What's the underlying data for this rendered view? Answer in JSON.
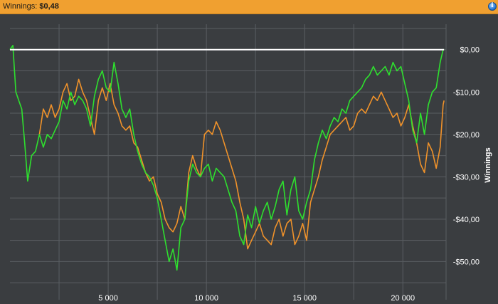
{
  "header": {
    "label": "Winnings:",
    "value": "$0,48",
    "info_icon": "info-icon"
  },
  "colors": {
    "background": "#3a3d40",
    "grid": "#5a5e62",
    "green": "#2ee02e",
    "orange": "#f0922a",
    "white": "#ffffff",
    "header": "#f0a030"
  },
  "chart_data": {
    "type": "line",
    "title": "",
    "xlabel": "",
    "ylabel": "Winnings",
    "grid": true,
    "legend": "none",
    "xlim": [
      0,
      22200
    ],
    "ylim": [
      -59,
      6
    ],
    "x_ticks": [
      5000,
      10000,
      15000,
      20000
    ],
    "x_tick_labels": [
      "5 000",
      "10 000",
      "15 000",
      "20 000"
    ],
    "y_ticks": [
      0,
      -10,
      -20,
      -30,
      -40,
      -50
    ],
    "y_tick_labels": [
      "$0,00",
      "-$10,00",
      "-$20,00",
      "-$30,00",
      "-$40,00",
      "-$50,00"
    ],
    "series": [
      {
        "color": "#2ee02e",
        "x": [
          0,
          150,
          300,
          450,
          600,
          750,
          900,
          1100,
          1300,
          1500,
          1700,
          1900,
          2100,
          2300,
          2500,
          2700,
          2900,
          3100,
          3300,
          3500,
          3700,
          3900,
          4100,
          4300,
          4500,
          4700,
          4900,
          5100,
          5300,
          5500,
          5700,
          5900,
          6100,
          6300,
          6500,
          6700,
          6900,
          7100,
          7300,
          7500,
          7700,
          7900,
          8100,
          8300,
          8500,
          8700,
          8900,
          9100,
          9300,
          9500,
          9700,
          9900,
          10100,
          10300,
          10500,
          10700,
          10900,
          11100,
          11300,
          11500,
          11700,
          11900,
          12100,
          12300,
          12500,
          12700,
          12900,
          13100,
          13300,
          13500,
          13700,
          13900,
          14100,
          14300,
          14500,
          14700,
          14900,
          15100,
          15300,
          15500,
          15700,
          15900,
          16100,
          16300,
          16500,
          16700,
          16900,
          17100,
          17300,
          17500,
          17700,
          17900,
          18100,
          18300,
          18500,
          18700,
          18900,
          19100,
          19300,
          19500,
          19700,
          19900,
          20100,
          20300,
          20500,
          20700,
          20900,
          21100,
          21300,
          21500,
          21700,
          21900,
          22050,
          22100
        ],
        "y": [
          0,
          1,
          -10,
          -12,
          -14,
          -22,
          -31,
          -25,
          -24,
          -20,
          -23,
          -20,
          -21,
          -19,
          -17,
          -12,
          -14,
          -10,
          -13,
          -11,
          -12,
          -14,
          -18,
          -11,
          -7,
          -5,
          -9,
          -10,
          -3,
          -8,
          -14,
          -16,
          -14,
          -20,
          -24,
          -27,
          -29,
          -30,
          -32,
          -35,
          -40,
          -45,
          -50,
          -47,
          -52,
          -42,
          -40,
          -31,
          -27,
          -29,
          -30,
          -28,
          -27,
          -31,
          -28,
          -29,
          -30,
          -33,
          -36,
          -38,
          -44,
          -46,
          -39,
          -42,
          -37,
          -41,
          -38,
          -36,
          -40,
          -37,
          -33,
          -31,
          -39,
          -33,
          -30,
          -38,
          -40,
          -36,
          -33,
          -26,
          -22,
          -19,
          -21,
          -18,
          -16,
          -17,
          -14,
          -15,
          -12,
          -11,
          -10,
          -9,
          -7,
          -6,
          -4,
          -6,
          -5,
          -4,
          -6,
          -3,
          -5,
          -4,
          -8,
          -12,
          -19,
          -22,
          -15,
          -20,
          -13,
          -10,
          -9,
          -3,
          0,
          0
        ]
      },
      {
        "color": "#f0922a",
        "x": [
          1500,
          1700,
          1900,
          2100,
          2300,
          2500,
          2700,
          2900,
          3100,
          3300,
          3500,
          3700,
          3900,
          4100,
          4300,
          4500,
          4700,
          4900,
          5100,
          5300,
          5500,
          5700,
          5900,
          6100,
          6300,
          6500,
          6700,
          6900,
          7100,
          7300,
          7500,
          7700,
          7900,
          8100,
          8300,
          8500,
          8700,
          8900,
          9100,
          9300,
          9500,
          9700,
          9900,
          10100,
          10300,
          10500,
          10700,
          10900,
          11100,
          11300,
          11500,
          11700,
          11900,
          12100,
          12300,
          12500,
          12700,
          12900,
          13100,
          13300,
          13500,
          13700,
          13900,
          14100,
          14300,
          14500,
          14700,
          14900,
          15100,
          15300,
          15500,
          15700,
          15900,
          16100,
          16300,
          16500,
          16700,
          16900,
          17100,
          17300,
          17500,
          17700,
          17900,
          18100,
          18300,
          18500,
          18700,
          18900,
          19100,
          19300,
          19500,
          19700,
          19900,
          20100,
          20300,
          20500,
          20700,
          20900,
          21100,
          21300,
          21500,
          21700,
          21900,
          22050,
          22100
        ],
        "y": [
          -20,
          -14,
          -16,
          -13,
          -16,
          -14,
          -10,
          -8,
          -12,
          -11,
          -7,
          -10,
          -12,
          -16,
          -20,
          -12,
          -9,
          -12,
          -8,
          -13,
          -15,
          -18,
          -19,
          -18,
          -22,
          -23,
          -26,
          -29,
          -31,
          -30,
          -34,
          -36,
          -40,
          -42,
          -43,
          -41,
          -37,
          -40,
          -29,
          -25,
          -28,
          -30,
          -20,
          -19,
          -20,
          -17,
          -19,
          -22,
          -25,
          -28,
          -31,
          -36,
          -40,
          -47,
          -45,
          -43,
          -41,
          -44,
          -45,
          -46,
          -42,
          -40,
          -44,
          -41,
          -40,
          -46,
          -44,
          -41,
          -45,
          -36,
          -33,
          -30,
          -26,
          -23,
          -20,
          -19,
          -18,
          -17,
          -16,
          -19,
          -18,
          -15,
          -14,
          -15,
          -13,
          -11,
          -12,
          -10,
          -12,
          -14,
          -16,
          -15,
          -18,
          -16,
          -13,
          -18,
          -22,
          -27,
          -29,
          -22,
          -24,
          -28,
          -23,
          -13,
          -12
        ]
      },
      {
        "color": "#ffffff",
        "x": [
          0,
          22100
        ],
        "y": [
          0,
          0
        ]
      }
    ]
  }
}
